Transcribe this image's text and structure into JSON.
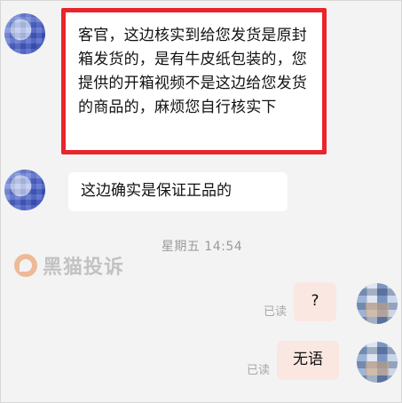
{
  "messages": [
    {
      "side": "left",
      "text": "客官，这边核实到给您发货是原封箱发货的，是有牛皮纸包装的，您提供的开箱视频不是这边给您发货的商品的，麻烦您自行核实下"
    },
    {
      "side": "left",
      "text": "这边确实是保证正品的"
    },
    {
      "side": "right",
      "text": "?",
      "status": "已读"
    },
    {
      "side": "right",
      "text": "无语",
      "status": "已读"
    }
  ],
  "timestamp": "星期五 14:54",
  "watermark": {
    "text": "黑猫投诉"
  },
  "colors": {
    "highlight_border": "#e8252b",
    "right_bubble": "#fbe7e1",
    "background": "#f3f3f3"
  }
}
